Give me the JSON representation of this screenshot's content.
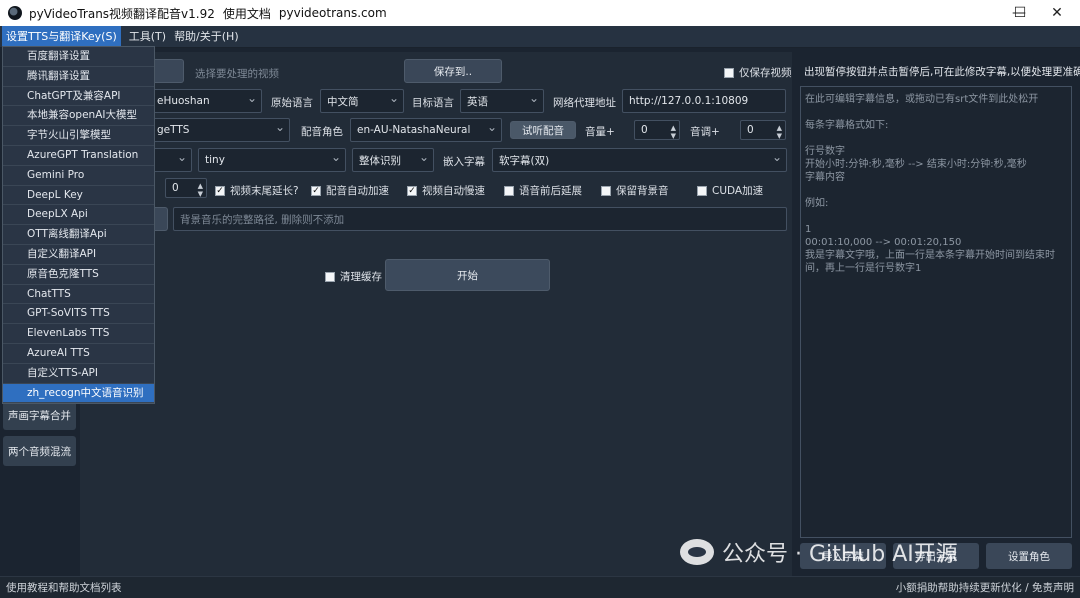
{
  "titlebar": {
    "title": "pyVideoTrans视频翻译配音v1.92",
    "doc_link": "使用文档",
    "site_link": "pyvideotrans.com",
    "minimize": "—",
    "maximize": "☐",
    "close": "✕"
  },
  "menubar": {
    "items": [
      "设置TTS与翻译Key(S)",
      "工具(T)",
      "帮助/关于(H)"
    ]
  },
  "dropdown": {
    "items": [
      "百度翻译设置",
      "腾讯翻译设置",
      "ChatGPT及兼容API",
      "本地兼容openAI大模型",
      "字节火山引擎模型",
      "AzureGPT Translation",
      "Gemini Pro",
      "DeepL Key",
      "DeepLX Api",
      "OTT离线翻译Api",
      "自定义翻译API",
      "原音色克隆TTS",
      "ChatTTS",
      "GPT-SoVITS TTS",
      "ElevenLabs TTS",
      "AzureAI TTS",
      "自定义TTS-API",
      "zh_recogn中文语音识别"
    ],
    "selected_index": 17
  },
  "sidebar": {
    "buttons": [
      "声画字幕合并",
      "两个音频混流"
    ]
  },
  "main": {
    "video_placeholder": "选择要处理的视频",
    "save_to": "保存到..",
    "only_save_video": "仅保存视频",
    "translate_channel": "eHuoshan",
    "source_lang_label": "原始语言",
    "source_lang": "中文简",
    "target_lang_label": "目标语言",
    "target_lang": "英语",
    "proxy_label": "网络代理地址",
    "proxy_value": "http://127.0.0.1:10809",
    "tts_type": "geTTS",
    "voice_role_label": "配音角色",
    "voice_role": "en-AU-NatashaNeural",
    "listen_btn": "试听配音",
    "volume_label": "音量+",
    "volume_value": "0",
    "pitch_label": "音调+",
    "pitch_value": "0",
    "model": "tiny",
    "recognition_mode": "整体识别",
    "embed_sub_label": "嵌入字幕",
    "embed_sub": "软字幕(双)",
    "speed_value": "0",
    "checks": [
      {
        "label": "视频末尾延长?",
        "checked": true
      },
      {
        "label": "配音自动加速",
        "checked": true
      },
      {
        "label": "视频自动慢速",
        "checked": true
      },
      {
        "label": "语音前后延展",
        "checked": false
      },
      {
        "label": "保留背景音",
        "checked": false
      },
      {
        "label": "CUDA加速",
        "checked": false
      }
    ],
    "bgm_placeholder": "背景音乐的完整路径, 删除则不添加",
    "clear_cache": "清理缓存",
    "start": "开始"
  },
  "right": {
    "title": "出现暂停按钮并点击暂停后,可在此修改字幕,以便处理更准确",
    "srt_lines": [
      "在此可编辑字幕信息，或拖动已有srt文件到此处松开",
      "",
      "每条字幕格式如下:",
      "",
      "行号数字",
      "开始小时:分钟:秒,毫秒 --> 结束小时:分钟:秒,毫秒",
      "字幕内容",
      "",
      "例如:",
      "",
      "1",
      "00:01:10,000 --> 00:01:20,150",
      "我是字幕文字哦，上面一行是本条字幕开始时间到结束时",
      "间，再上一行是行号数字1"
    ],
    "import_sub": "导入字幕",
    "export_sub": "导出字幕",
    "set_role": "设置角色"
  },
  "statusbar": {
    "left": "使用教程和帮助文档列表",
    "right": "小额捐助帮助持续更新优化 / 免责声明"
  },
  "watermark": {
    "text": "公众号 · GitHub AI开源"
  }
}
